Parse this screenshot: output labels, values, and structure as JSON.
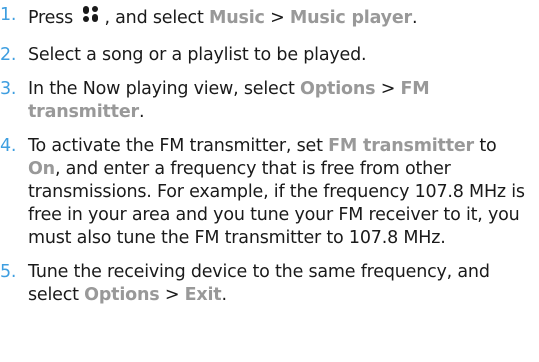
{
  "steps": [
    {
      "num": "1.",
      "t1": "Press",
      "t2": ", and select",
      "k1": "Music",
      "sep": ">",
      "k2": "Music player",
      "end": "."
    },
    {
      "num": "2.",
      "text": "Select a song or a playlist to be played."
    },
    {
      "num": "3.",
      "t1": "In the Now playing view, select",
      "k1": "Options",
      "sep": ">",
      "k2": "FM transmitter",
      "end": "."
    },
    {
      "num": "4.",
      "t1": "To activate the FM transmitter, set",
      "k1": "FM transmitter",
      "t2": "to",
      "k2": "On",
      "t3": ", and enter a frequency that is free from other transmissions. For example, if the frequency 107.8 MHz is free in your area and you tune your FM receiver to it, you must also tune the FM transmitter to 107.8 MHz."
    },
    {
      "num": "5.",
      "t1": "Tune the receiving device to the same frequency, and select",
      "k1": "Options",
      "sep": ">",
      "k2": "Exit",
      "end": "."
    }
  ],
  "icons": {
    "menu_key": "menu-key-icon"
  },
  "colors": {
    "step_number": "#3e9ee0",
    "highlight": "#999999",
    "text": "#1a1a1a"
  }
}
